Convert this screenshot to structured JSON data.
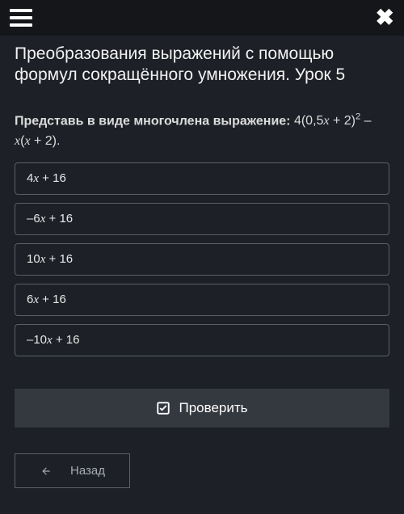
{
  "header": {
    "menu_icon": "hamburger-menu",
    "close_icon": "close"
  },
  "lesson": {
    "title": "Преобразования выражений с помощью формул сокращённого умножения. Урок 5"
  },
  "question": {
    "prompt_label": "Представь в виде многочлена выражение:",
    "expression_prefix": "4(0,5",
    "expression_var1": "x",
    "expression_mid1": " + 2)",
    "expression_sup": "2",
    "expression_mid2": " – ",
    "expression_var2": "x",
    "expression_mid3": "(",
    "expression_var3": "x",
    "expression_suffix": " + 2)."
  },
  "options": [
    {
      "pre": "4",
      "var": "x",
      "post": " + 16"
    },
    {
      "pre": "–6",
      "var": "x",
      "post": " + 16"
    },
    {
      "pre": "10",
      "var": "x",
      "post": " + 16"
    },
    {
      "pre": "6",
      "var": "x",
      "post": " + 16"
    },
    {
      "pre": "–10",
      "var": "x",
      "post": " + 16"
    }
  ],
  "buttons": {
    "submit": "Проверить",
    "back": "Назад"
  }
}
